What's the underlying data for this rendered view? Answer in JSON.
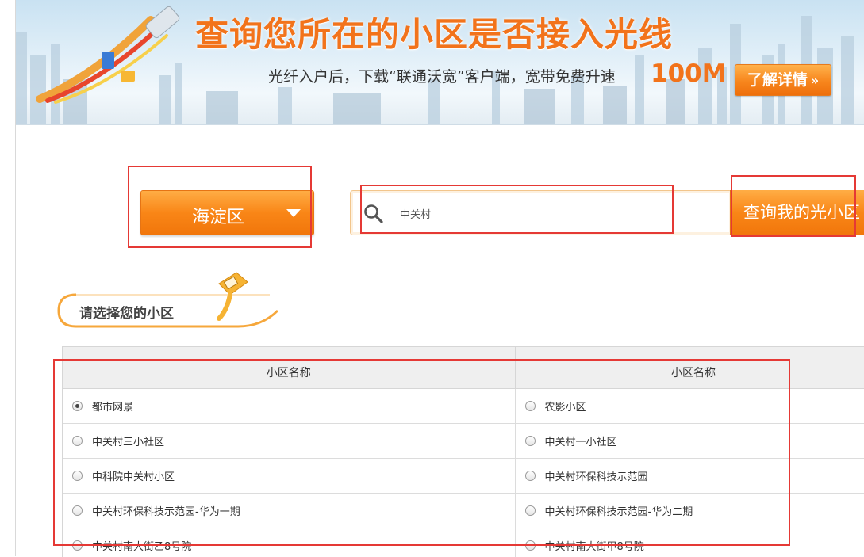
{
  "banner": {
    "title": "查询您所在的小区是否接入光线",
    "subtitle": "光纤入户后，下载“联通沃宽”客户端，宽带免费升速",
    "speed": "100M",
    "details_label": "了解详情",
    "details_arrow": "»"
  },
  "filter": {
    "district": "海淀区",
    "search_value": "中关村",
    "query_label": "查询我的光小区"
  },
  "section": {
    "label": "请选择您的小区"
  },
  "table": {
    "headers": [
      "小区名称",
      "小区名称"
    ],
    "rows": [
      [
        {
          "name": "都市网景",
          "checked": true
        },
        {
          "name": "农影小区",
          "checked": false
        }
      ],
      [
        {
          "name": "中关村三小社区",
          "checked": false
        },
        {
          "name": "中关村一小社区",
          "checked": false
        }
      ],
      [
        {
          "name": "中科院中关村小区",
          "checked": false
        },
        {
          "name": "中关村环保科技示范园",
          "checked": false
        }
      ],
      [
        {
          "name": "中关村环保科技示范园-华为一期",
          "checked": false
        },
        {
          "name": "中关村环保科技示范园-华为二期",
          "checked": false
        }
      ],
      [
        {
          "name": "中关村南大街乙8号院",
          "checked": false
        },
        {
          "name": "中关村南大街甲8号院",
          "checked": false
        }
      ]
    ]
  },
  "colors": {
    "accent": "#f2731b",
    "annotation": "#e53935"
  }
}
